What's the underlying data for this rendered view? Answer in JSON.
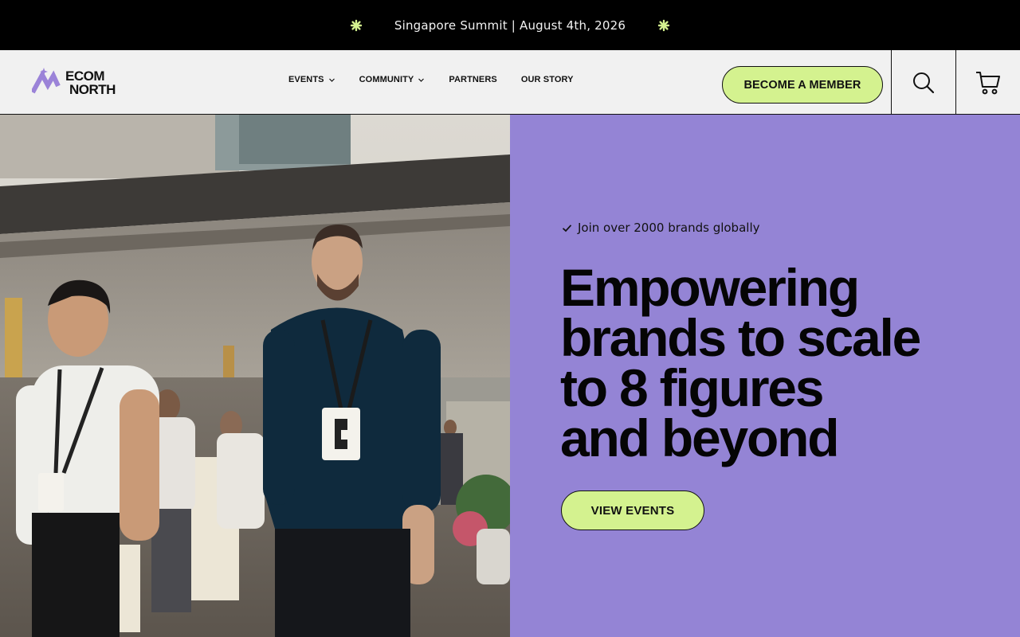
{
  "announcement": {
    "text": "Singapore Summit | August 4th, 2026"
  },
  "brand": {
    "line1": "ECOM",
    "line2": "NORTH"
  },
  "nav": {
    "items": [
      {
        "label": "EVENTS",
        "has_dropdown": true
      },
      {
        "label": "COMMUNITY",
        "has_dropdown": true
      },
      {
        "label": "PARTNERS",
        "has_dropdown": false
      },
      {
        "label": "OUR STORY",
        "has_dropdown": false
      }
    ]
  },
  "header": {
    "member_button": "BECOME A MEMBER"
  },
  "hero": {
    "tagline": "Join over 2000 brands globally",
    "headline_lines": [
      "Empowering",
      "brands to scale",
      "to 8 figures",
      "and beyond"
    ],
    "cta": "VIEW EVENTS"
  },
  "colors": {
    "accent_green": "#d4f28f",
    "hero_purple": "#9484d5",
    "logo_purple": "#9b83d8"
  },
  "icons": [
    "asterisk-icon",
    "chevron-down-icon",
    "search-icon",
    "cart-icon",
    "check-icon"
  ]
}
